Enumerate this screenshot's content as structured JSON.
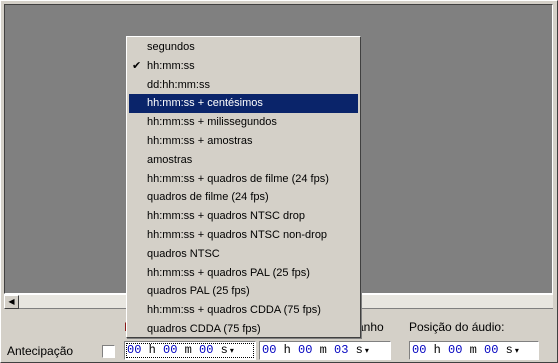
{
  "menu": {
    "items": [
      {
        "label": "segundos",
        "checked": false,
        "highlighted": false
      },
      {
        "label": "hh:mm:ss",
        "checked": true,
        "highlighted": false
      },
      {
        "label": "dd:hh:mm:ss",
        "checked": false,
        "highlighted": false
      },
      {
        "label": "hh:mm:ss + centésimos",
        "checked": false,
        "highlighted": true
      },
      {
        "label": "hh:mm:ss + milissegundos",
        "checked": false,
        "highlighted": false
      },
      {
        "label": "hh:mm:ss + amostras",
        "checked": false,
        "highlighted": false
      },
      {
        "label": "amostras",
        "checked": false,
        "highlighted": false
      },
      {
        "label": "hh:mm:ss + quadros de filme (24 fps)",
        "checked": false,
        "highlighted": false
      },
      {
        "label": "quadros de filme (24 fps)",
        "checked": false,
        "highlighted": false
      },
      {
        "label": "hh:mm:ss + quadros NTSC drop",
        "checked": false,
        "highlighted": false
      },
      {
        "label": "hh:mm:ss + quadros NTSC non-drop",
        "checked": false,
        "highlighted": false
      },
      {
        "label": "quadros NTSC",
        "checked": false,
        "highlighted": false
      },
      {
        "label": "hh:mm:ss + quadros PAL (25 fps)",
        "checked": false,
        "highlighted": false
      },
      {
        "label": "quadros PAL (25 fps)",
        "checked": false,
        "highlighted": false
      },
      {
        "label": "hh:mm:ss + quadros CDDA (75 fps)",
        "checked": false,
        "highlighted": false
      },
      {
        "label": "quadros CDDA (75 fps)",
        "checked": false,
        "highlighted": false
      }
    ],
    "check_glyph": "✔"
  },
  "toolbar": {
    "label_partial_left": "I",
    "label_partial_size": "anho",
    "label_audio_position": "Posição do áudio:",
    "label_snap": "Antecipação",
    "scroll_left_arrow": "◀",
    "dropdown_arrow": "▾"
  },
  "fields": {
    "selection_start": [
      {
        "t": "d",
        "v": "0"
      },
      {
        "t": "d",
        "v": "0"
      },
      {
        "t": "u",
        "v": " h "
      },
      {
        "t": "d",
        "v": "0"
      },
      {
        "t": "d",
        "v": "0"
      },
      {
        "t": "u",
        "v": " m "
      },
      {
        "t": "d",
        "v": "0"
      },
      {
        "t": "d",
        "v": "0"
      },
      {
        "t": "u",
        "v": " s"
      }
    ],
    "selection_size": [
      {
        "t": "d",
        "v": "0"
      },
      {
        "t": "d",
        "v": "0"
      },
      {
        "t": "u",
        "v": " h "
      },
      {
        "t": "d",
        "v": "0"
      },
      {
        "t": "d",
        "v": "0"
      },
      {
        "t": "u",
        "v": " m "
      },
      {
        "t": "d",
        "v": "0"
      },
      {
        "t": "d",
        "v": "3"
      },
      {
        "t": "u",
        "v": " s"
      }
    ],
    "audio_position": [
      {
        "t": "d",
        "v": "0"
      },
      {
        "t": "d",
        "v": "0"
      },
      {
        "t": "u",
        "v": " h "
      },
      {
        "t": "d",
        "v": "0"
      },
      {
        "t": "d",
        "v": "0"
      },
      {
        "t": "u",
        "v": " m "
      },
      {
        "t": "d",
        "v": "0"
      },
      {
        "t": "d",
        "v": "0"
      },
      {
        "t": "u",
        "v": " s"
      }
    ]
  }
}
